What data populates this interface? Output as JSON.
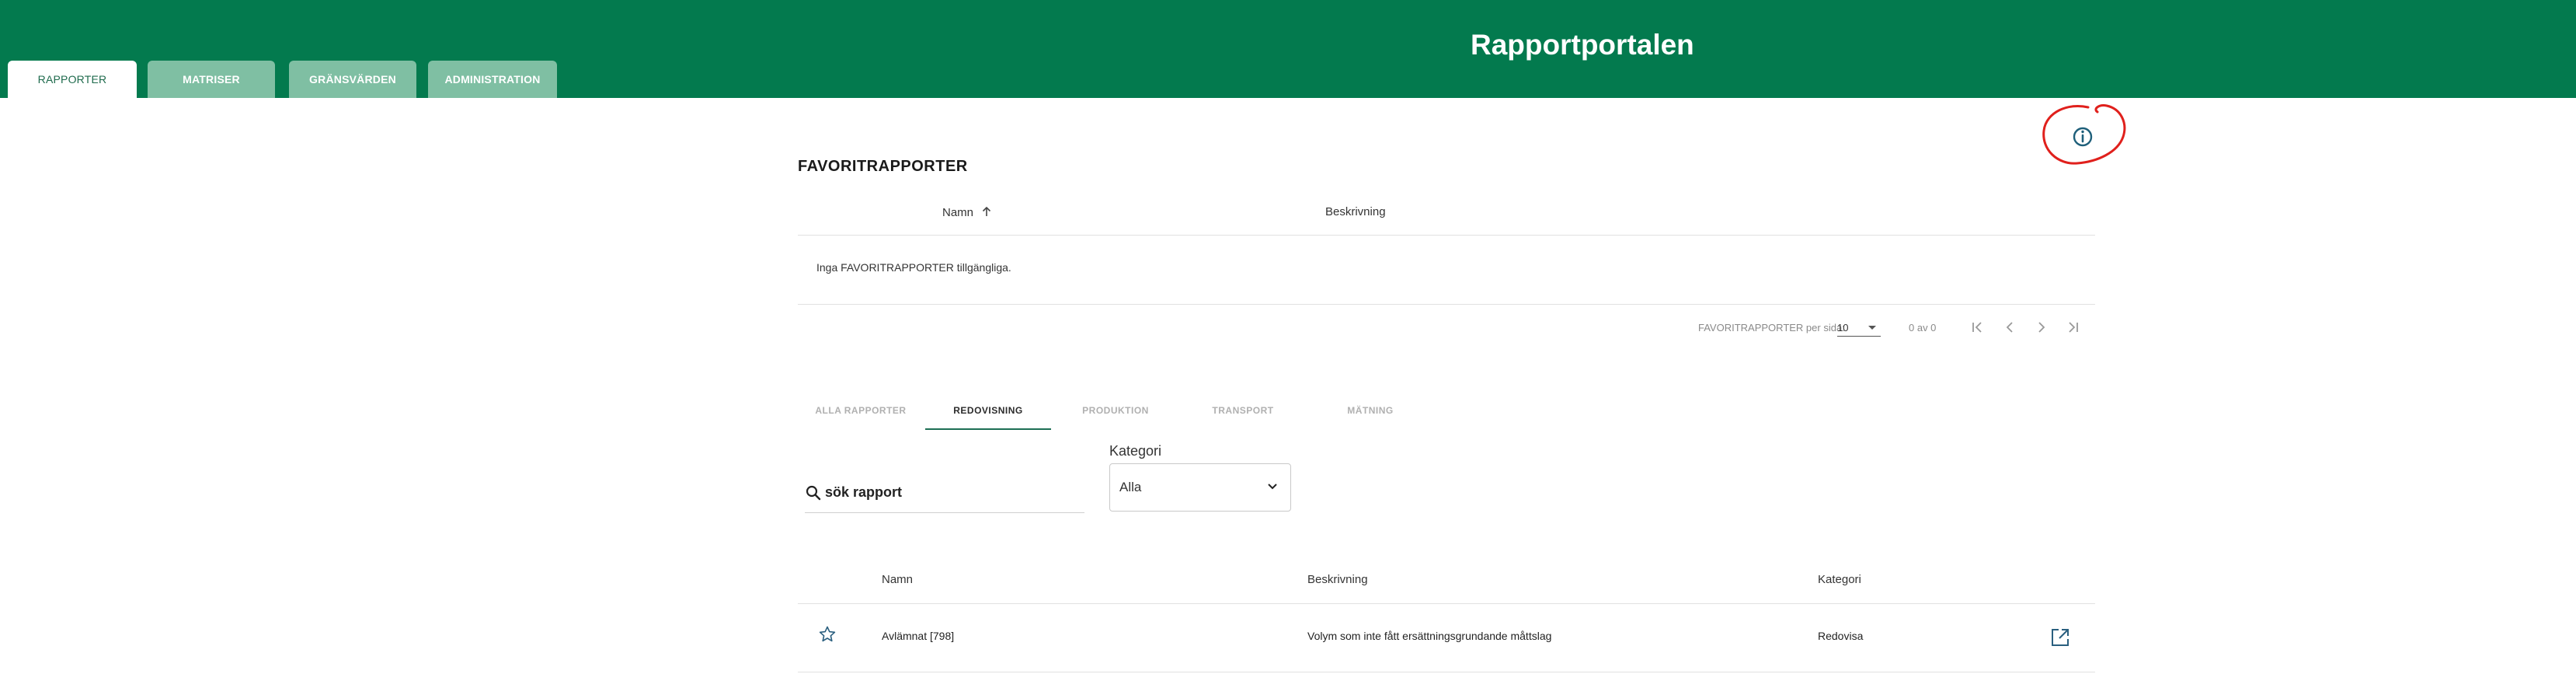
{
  "header": {
    "title": "Rapportportalen",
    "background_color": "#037a4e",
    "tabs": [
      {
        "label": "RAPPORTER",
        "active": true
      },
      {
        "label": "MATRISER",
        "active": false
      },
      {
        "label": "GRÄNSVÄRDEN",
        "active": false
      },
      {
        "label": "ADMINISTRATION",
        "active": false
      }
    ]
  },
  "info_icon": "info-circle-icon",
  "favorites": {
    "title": "FAVORITRAPPORTER",
    "columns": {
      "name": "Namn",
      "name_sort_icon": "arrow-up-icon",
      "description": "Beskrivning"
    },
    "empty_message": "Inga FAVORITRAPPORTER tillgängliga.",
    "pagination": {
      "per_page_label": "FAVORITRAPPORTER per sida:",
      "per_page_value": "10",
      "range": "0 av 0",
      "buttons": [
        "first-page-icon",
        "previous-page-icon",
        "next-page-icon",
        "last-page-icon"
      ]
    }
  },
  "category_tabs": [
    {
      "label": "ALLA RAPPORTER",
      "active": false
    },
    {
      "label": "REDOVISNING",
      "active": true
    },
    {
      "label": "PRODUKTION",
      "active": false
    },
    {
      "label": "TRANSPORT",
      "active": false
    },
    {
      "label": "MÄTNING",
      "active": false
    }
  ],
  "search": {
    "placeholder": "sök rapport",
    "value": ""
  },
  "category_filter": {
    "label": "Kategori",
    "selected": "Alla"
  },
  "reports": {
    "columns": {
      "name": "Namn",
      "description": "Beskrivning",
      "category": "Kategori"
    },
    "rows": [
      {
        "favorite_icon": "star-outline-icon",
        "name": "Avlämnat [798]",
        "description": "Volym som inte fått ersättningsgrundande måttslag",
        "category": "Redovisa",
        "action_icon": "open-in-new-icon"
      }
    ]
  },
  "colors": {
    "primary": "#037a4e",
    "tab_inactive": "#7fbfa3",
    "annotation": "#e0201c"
  }
}
